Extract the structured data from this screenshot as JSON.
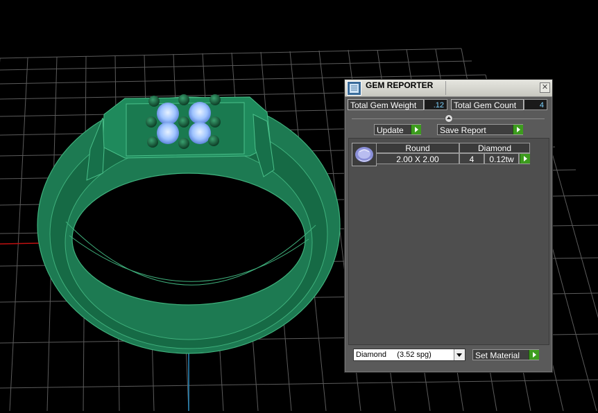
{
  "panel": {
    "title": "GEM REPORTER",
    "close_symbol": "✕",
    "total_gem_weight_label": "Total Gem Weight",
    "total_gem_weight_value": ".12",
    "total_gem_count_label": "Total Gem Count",
    "total_gem_count_value": "4",
    "update_label": "Update",
    "save_report_label": "Save Report",
    "table": {
      "headers": [
        "Round",
        "Diamond"
      ],
      "row": {
        "size": "2.00 X 2.00",
        "count": "4",
        "weight": "0.12tw"
      }
    },
    "material_select_value": "Diamond     (3.52 spg)",
    "set_material_label": "Set Material"
  },
  "colors": {
    "ring": "#1d7a52",
    "gem": "#9fc4ff",
    "grid": "#5c5c5c",
    "axis_x": "#c01010",
    "axis_y": "#2a8cbf",
    "accent_green": "#3d9c1e"
  }
}
